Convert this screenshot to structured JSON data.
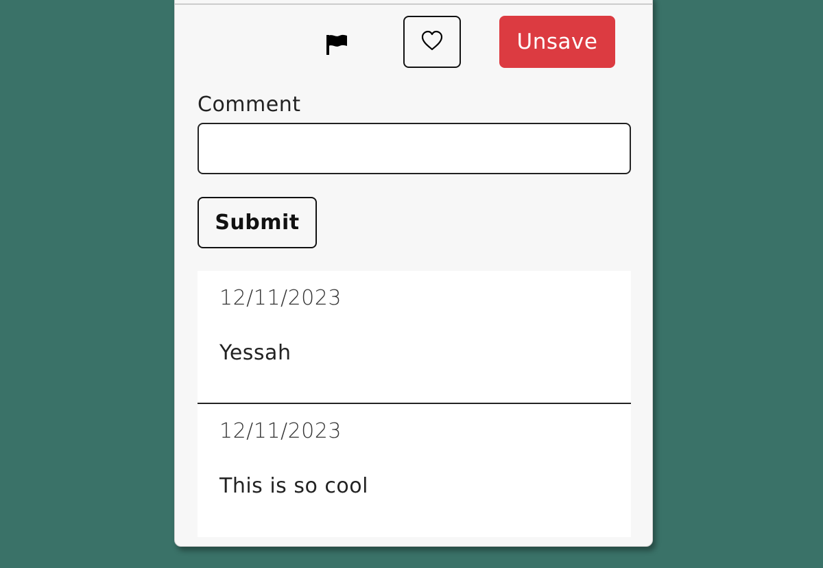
{
  "actions": {
    "unsave_label": "Unsave"
  },
  "comment_form": {
    "label": "Comment",
    "value": "",
    "placeholder": "",
    "submit_label": "Submit"
  },
  "comments": [
    {
      "date": "12/11/2023",
      "text": "Yessah"
    },
    {
      "date": "12/11/2023",
      "text": "This is so cool"
    }
  ],
  "icons": {
    "flag": "flag-icon",
    "heart": "heart-outline-icon"
  },
  "colors": {
    "page_background": "#3a7268",
    "card_background": "#f7f7f7",
    "unsave_button": "#dc3b41"
  }
}
